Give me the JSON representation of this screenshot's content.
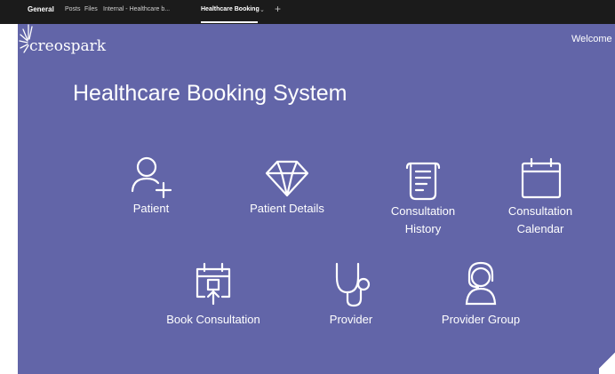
{
  "tabs": {
    "general": "General",
    "posts": "Posts",
    "files": "Files",
    "internal": "Internal - Healthcare b...",
    "active": "Healthcare Booking",
    "chevron": "⌄",
    "add": "+"
  },
  "header": {
    "logo_text": "creospark",
    "welcome": "Welcome"
  },
  "main": {
    "title": "Healthcare Booking System",
    "tiles": [
      {
        "label": "Patient",
        "icon": "person-add-icon"
      },
      {
        "label": "Patient Details",
        "icon": "diamond-icon"
      },
      {
        "label": "Consultation History",
        "line1": "Consultation",
        "line2": "History",
        "icon": "document-icon"
      },
      {
        "label": "Consultation Calendar",
        "line1": "Consultation",
        "line2": "Calendar",
        "icon": "calendar-icon"
      },
      {
        "label": "Book Consultation",
        "icon": "calendar-upload-icon"
      },
      {
        "label": "Provider",
        "icon": "stethoscope-icon"
      },
      {
        "label": "Provider Group",
        "icon": "headset-person-icon"
      }
    ]
  },
  "colors": {
    "tab_bar": "#1b1b1b",
    "app_background": "#6265a8",
    "foreground": "#ffffff"
  }
}
